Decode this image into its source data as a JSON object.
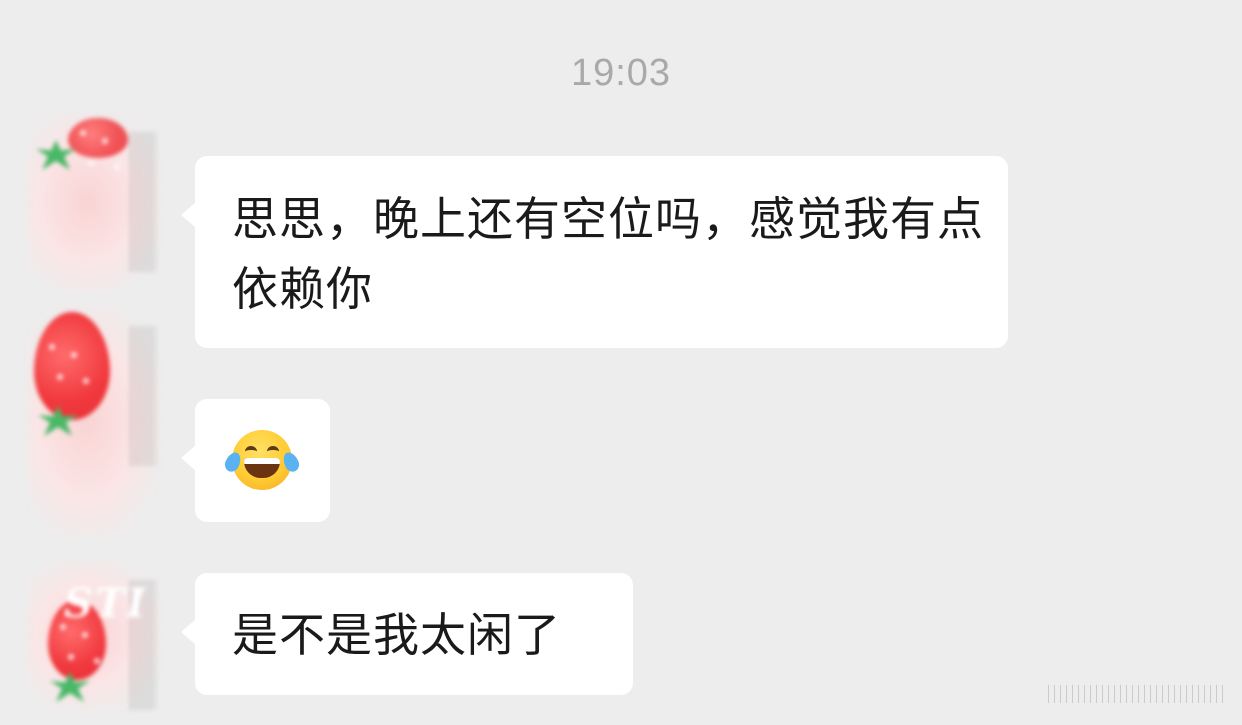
{
  "chat": {
    "timestamp": "19:03",
    "messages": [
      {
        "type": "text",
        "text": " 思思，晚上还有空位吗，感觉我有点依赖你"
      },
      {
        "type": "emoji",
        "icon": "face-with-tears-of-joy-icon"
      },
      {
        "type": "text",
        "text": "是不是我太闲了"
      }
    ]
  },
  "avatar": {
    "overlay_text": "STI"
  },
  "colors": {
    "background": "#ededed",
    "bubble": "#ffffff",
    "timestamp": "#a9a9a9",
    "text": "#1a1a1a"
  }
}
